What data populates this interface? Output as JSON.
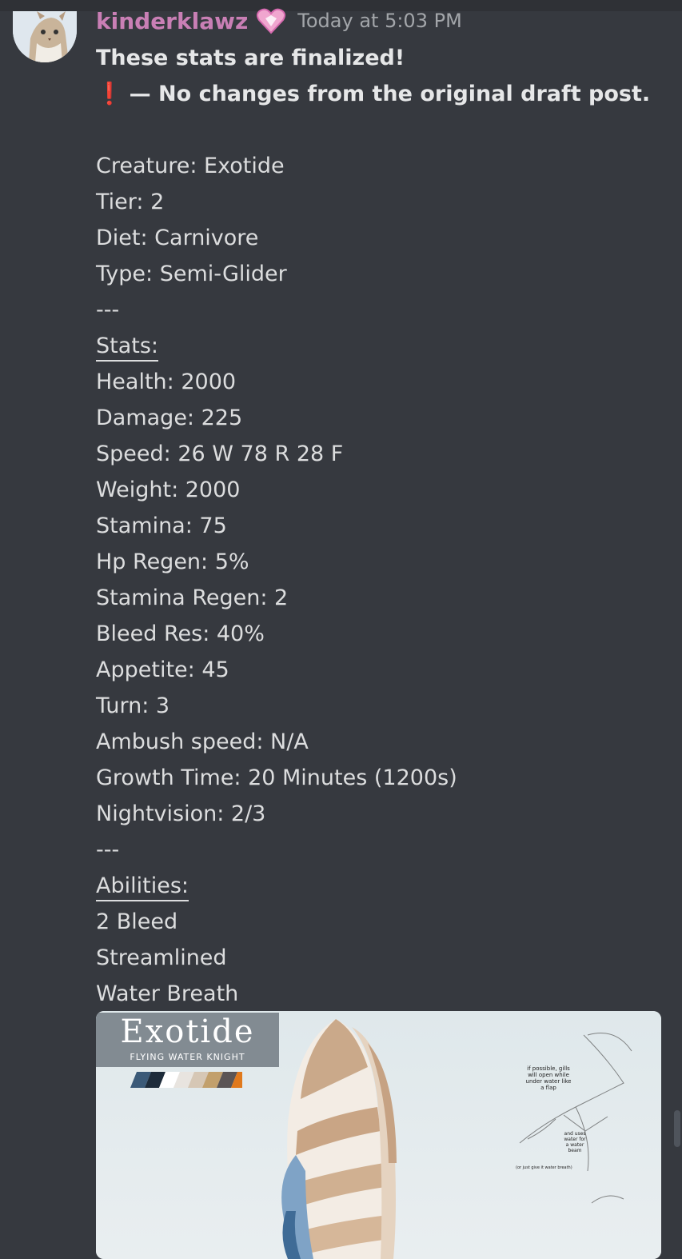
{
  "message": {
    "username": "kinderklawz",
    "timestamp": "Today at 5:03 PM",
    "line1": "These stats are finalized!",
    "line2_icon": "exclamation-icon",
    "line2_text": "— No changes from the original draft post.",
    "creature": "Creature: Exotide",
    "tier": "Tier: 2",
    "diet": "Diet: Carnivore",
    "type": "Type: Semi-Glider",
    "separator": "---",
    "stats_heading": "Stats:",
    "stats": [
      "Health: 2000",
      "Damage: 225",
      "Speed: 26 W 78 R 28 F",
      "Weight: 2000",
      "Stamina: 75",
      "Hp Regen: 5%",
      "Stamina Regen: 2",
      "Bleed Res: 40%",
      "Appetite: 45",
      "Turn: 3",
      "Ambush speed: N/A",
      "Growth Time: 20 Minutes (1200s)",
      "Nightvision: 2/3"
    ],
    "abilities_heading": "Abilities:",
    "abilities": [
      "2 Bleed",
      "Streamlined",
      "Water Breath"
    ]
  },
  "embed": {
    "title": "Exotide",
    "subtitle": "FLYING WATER KNIGHT",
    "palette": [
      "#3b5a78",
      "#1d2b3a",
      "#ffffff",
      "#e8e4df",
      "#d6c7b5",
      "#c2a06c",
      "#5b5555",
      "#e0791c"
    ],
    "note1": [
      "if possible, gills",
      "will open while",
      "under water like",
      "a flap"
    ],
    "note2": [
      "and uses",
      "water for",
      "a water",
      "beam"
    ],
    "note3": "(or just give it water breath)"
  }
}
